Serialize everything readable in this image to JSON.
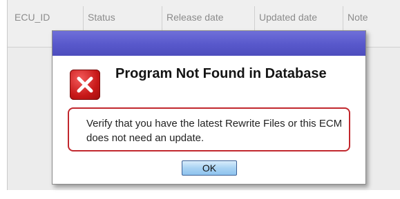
{
  "table": {
    "columns": [
      "ECU_ID",
      "Status",
      "Release date",
      "Updated date",
      "Note"
    ]
  },
  "dialog": {
    "title": "Program Not Found in Database",
    "message": "Verify that you have the latest Rewrite Files or this ECM does not need an update.",
    "ok_label": "OK",
    "icon": "error-x-icon"
  },
  "colors": {
    "titlebar": "#5858cb",
    "error_icon": "#c71818",
    "message_border": "#c1272d",
    "ok_button": "#a9d3f3"
  }
}
